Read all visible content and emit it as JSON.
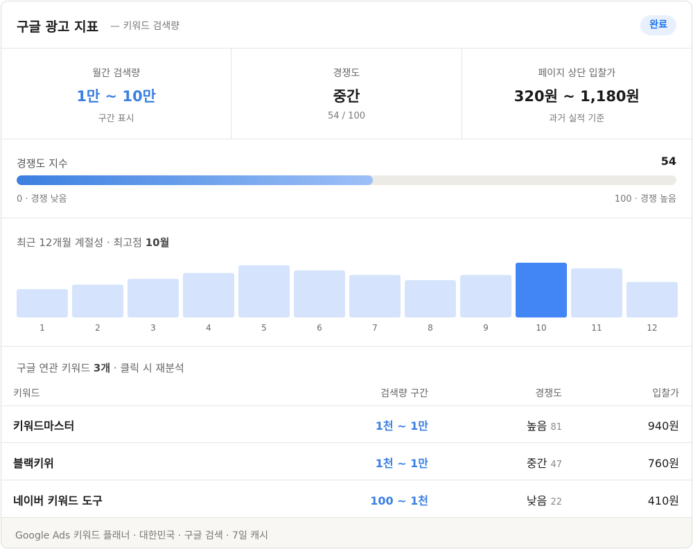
{
  "header": {
    "title": "구글 광고 지표",
    "subtitle": "— 키워드 검색량",
    "status_badge": "완료"
  },
  "stats": [
    {
      "label": "월간 검색량",
      "value": "1만 ~ 10만",
      "note": "구간 표시"
    },
    {
      "label": "경쟁도",
      "value": "중간",
      "note": "54 / 100"
    },
    {
      "label": "페이지 상단 입찰가",
      "value": "320원 ~ 1,180원",
      "note": "과거 실적 기준"
    }
  ],
  "competition": {
    "label": "경쟁도 지수",
    "score": "54",
    "fill_fraction": 0.54,
    "scale_low": "0 · 경쟁 낮음",
    "scale_high": "100 · 경쟁 높음"
  },
  "seasonality": {
    "title_prefix": "최근 12개월 계절성 · 최고점 ",
    "peak_label": "10월",
    "colors": {
      "bar": "#d5e4fc",
      "peak": "#4285f4",
      "tick": "#666666"
    }
  },
  "chart_data": {
    "type": "bar",
    "categories": [
      "1",
      "2",
      "3",
      "4",
      "5",
      "6",
      "7",
      "8",
      "9",
      "10",
      "11",
      "12"
    ],
    "values": [
      44,
      51,
      60,
      69,
      81,
      73,
      66,
      58,
      66,
      85,
      76,
      55
    ],
    "peak_index": 9,
    "ylim": [
      0,
      100
    ]
  },
  "related": {
    "title": "구글 연관 키워드 3개 · 클릭 시 재분석",
    "headers": {
      "keyword": "키워드",
      "volume": "검색량 구간",
      "competition": "경쟁도",
      "bid": "입찰가"
    },
    "rows": [
      {
        "keyword": "키워드마스터",
        "volume": "1천 ~ 1만",
        "competition": "높음",
        "competition_score": "81",
        "bid": "940원"
      },
      {
        "keyword": "블랙키위",
        "volume": "1천 ~ 1만",
        "competition": "중간",
        "competition_score": "47",
        "bid": "760원"
      },
      {
        "keyword": "네이버 키워드 도구",
        "volume": "100 ~ 1천",
        "competition": "낮음",
        "competition_score": "22",
        "bid": "410원"
      }
    ]
  },
  "footer": {
    "text": "Google Ads 키워드 플래너 · 대한민국 · 구글 검색 · 7일 캐시"
  }
}
